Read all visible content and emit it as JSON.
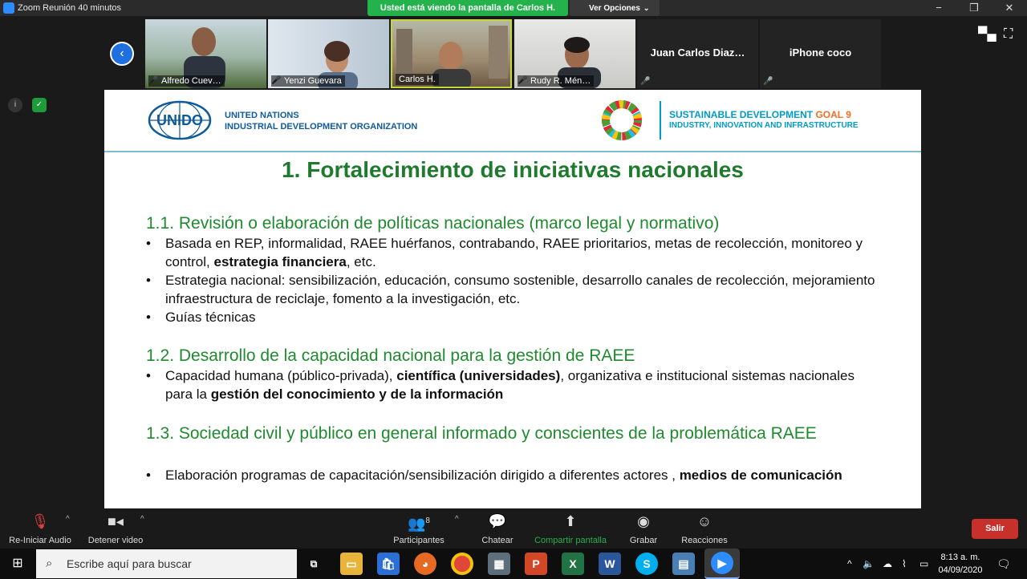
{
  "window": {
    "title": "Zoom Reunión 40 minutos",
    "share_banner": "Usted está viendo la pantalla de Carlos H.",
    "view_options": "Ver Opciones",
    "minimize": "−",
    "maximize": "❐",
    "close": "✕"
  },
  "participants": [
    {
      "name": "Alfredo Cuev…"
    },
    {
      "name": "Yenzi Guevara"
    },
    {
      "name": "Carlos H."
    },
    {
      "name": "Rudy R. Mén…"
    },
    {
      "name": "Juan  Carlos  Diaz…"
    },
    {
      "name": "iPhone coco"
    }
  ],
  "slide": {
    "org_line1": "UNITED NATIONS",
    "org_line2": "INDUSTRIAL DEVELOPMENT ORGANIZATION",
    "unido_logo_text": "UNIDO",
    "sdg_line1": "SUSTAINABLE DEVELOPMENT",
    "sdg_goal": "GOAL 9",
    "sdg_line2": "INDUSTRY, INNOVATION AND INFRASTRUCTURE",
    "title": "1. Fortalecimiento de iniciativas nacionales",
    "sections": [
      {
        "heading": "1.1. Revisión o elaboración de políticas nacionales (marco legal y normativo)",
        "bullets": [
          {
            "pre": "Basada en REP, informalidad, RAEE huérfanos, contrabando, RAEE prioritarios, metas de recolección, monitoreo y control, ",
            "bold": "estrategia financiera",
            "post": ", etc."
          },
          {
            "pre": "Estrategia nacional: sensibilización, educación, consumo sostenible, desarrollo canales de recolección, mejoramiento infraestructura de reciclaje, fomento a la investigación, etc.",
            "bold": "",
            "post": ""
          },
          {
            "pre": "Guías técnicas",
            "bold": "",
            "post": ""
          }
        ]
      },
      {
        "heading": "1.2. Desarrollo de la capacidad nacional para la gestión de RAEE",
        "bullets": [
          {
            "pre": "Capacidad humana (público-privada), ",
            "bold": "científica (universidades)",
            "post": ", organizativa e institucional sistemas nacionales para la ",
            "bold2": "gestión del conocimiento y de la información"
          }
        ]
      },
      {
        "heading": "1.3. Sociedad civil y público en general informado y conscientes de la problemática RAEE",
        "bullets": [
          {
            "pre": "Elaboración programas de capacitación/sensibilización dirigido a diferentes actores , ",
            "bold": "medios de comunicación",
            "post": ""
          }
        ]
      }
    ]
  },
  "toolbar": {
    "audio": "Re-Iniciar Audio",
    "video": "Detener video",
    "participants": "Participantes",
    "participants_count": "8",
    "chat": "Chatear",
    "share": "Compartir pantalla",
    "record": "Grabar",
    "reactions": "Reacciones",
    "leave": "Salir"
  },
  "taskbar": {
    "search_placeholder": "Escribe aquí para buscar",
    "time": "8:13 a. m.",
    "date": "04/09/2020"
  },
  "colors": {
    "share_green": "#23b24b",
    "slide_title_green": "#1f7a2e",
    "leave_red": "#c8302c",
    "zoom_blue": "#2d8cff"
  }
}
